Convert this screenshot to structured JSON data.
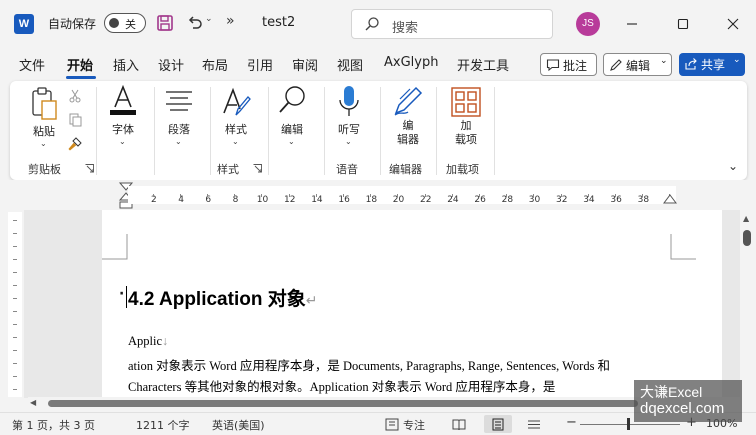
{
  "titlebar": {
    "logo_letter": "W",
    "autosave_label": "自动保存",
    "autosave_state": "关",
    "doc_name": "test2",
    "search_placeholder": "搜索",
    "user_initials": "JS"
  },
  "menu": {
    "tabs": [
      "文件",
      "开始",
      "插入",
      "设计",
      "布局",
      "引用",
      "审阅",
      "视图",
      "AxGlyph",
      "开发工具"
    ],
    "active_tab": "开始",
    "comment_label": "批注",
    "edit_label": "编辑",
    "share_label": "共享"
  },
  "ribbon": {
    "paste_label": "粘贴",
    "clipboard_group": "剪贴板",
    "font_label": "字体",
    "paragraph_label": "段落",
    "styles_label": "样式",
    "styles_group": "样式",
    "editing_label": "编辑",
    "dictate_label": "听写",
    "voice_group": "语音",
    "editor_label_1": "编",
    "editor_label_2": "辑器",
    "editor_group": "编辑器",
    "addins_label_1": "加",
    "addins_label_2": "载项",
    "addins_group": "加载项"
  },
  "ruler": {
    "numbers": [
      "2",
      "4",
      "6",
      "8",
      "10",
      "12",
      "14",
      "16",
      "18",
      "20",
      "22",
      "24",
      "26",
      "28",
      "30",
      "32",
      "34",
      "36",
      "38"
    ]
  },
  "document": {
    "heading": "4.2 Application  对象",
    "heading_mark": "↵",
    "line1": "Applic",
    "line1_mark": "↓",
    "line2": "ation 对象表示 Word 应用程序本身，是 Documents, Paragraphs, Range, Sentences, Words 和",
    "line3": "Characters 等其他对象的根对象。Application 对象表示 Word 应用程序本身，是"
  },
  "status": {
    "page": "第 1 页，共 3 页",
    "words": "1211 个字",
    "language": "英语(美国)",
    "focus": "专注",
    "zoom": "100%"
  },
  "watermark": {
    "line1": "大谦Excel",
    "line2": "dqexcel.com"
  }
}
